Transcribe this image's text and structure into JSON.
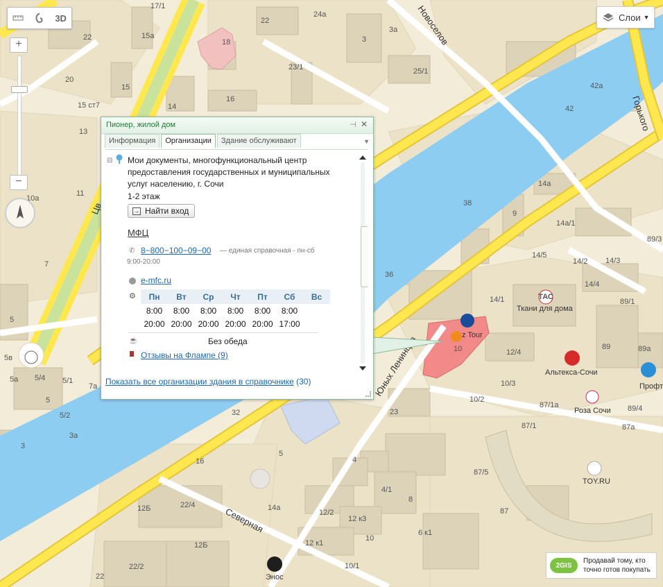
{
  "toolbar": {
    "ruler_icon": "ruler-icon",
    "lasso_icon": "lasso-icon",
    "mode_3d": "3D"
  },
  "zoom": {
    "plus": "+",
    "minus": "−"
  },
  "layers": {
    "label": "Слои"
  },
  "map": {
    "streets": [
      "Новоселов",
      "Горького",
      "Юных Ленинцев",
      "Северная",
      "Цв"
    ],
    "buildings": [
      "17/1",
      "24а",
      "22",
      "15а",
      "3а",
      "18",
      "22",
      "3",
      "20",
      "23/1",
      "25/1",
      "42а",
      "15 ст7",
      "15",
      "16",
      "14",
      "42",
      "13",
      "38",
      "9",
      "14а",
      "14а/1",
      "11",
      "10а",
      "7",
      "36",
      "14/5",
      "14/2",
      "14/3",
      "89/3",
      "14/4",
      "89/1",
      "14/1",
      "89",
      "89а",
      "12/4",
      "10",
      "5",
      "5в",
      "5а",
      "5/4",
      "5/1",
      "7а",
      "5",
      "5/2",
      "3а",
      "3",
      "32",
      "23",
      "10/3",
      "10/2",
      "87/1а",
      "89/4",
      "87а",
      "87/1",
      "87/5",
      "87",
      "12Б",
      "22/4",
      "16",
      "4",
      "5",
      "14а",
      "4/1",
      "8",
      "12/2",
      "12 к3",
      "6 к1",
      "12 к1",
      "10",
      "12Б",
      "22/2",
      "10/1",
      "22"
    ],
    "pois": {
      "tas": "Ткани для дома",
      "alteksa": "Альтекса-Сочи",
      "roza": "Роза Сочи",
      "toy": "TOY.RU",
      "profteks": "Профтекс",
      "enos": "Энос",
      "eztour": "z Tour"
    },
    "tas_logo": "ТАС"
  },
  "card": {
    "title": "Пионер, жилой дом",
    "tabs": [
      "Информация",
      "Организации",
      "Здание обслуживают"
    ],
    "active_tab": 1,
    "org": {
      "name": "Мои документы, многофункциональный центр предоставления государственных и муниципальных услуг населению, г. Сочи",
      "floor": "1-2 этаж",
      "find_entrance": "Найти вход",
      "category": "МФЦ",
      "phone": "8−800−100−09−00",
      "phone_note": "— единая справочная - пн-сб",
      "phone_hours": "9:00-20:00",
      "website": "e-mfc.ru",
      "hours": {
        "days": [
          "Пн",
          "Вт",
          "Ср",
          "Чт",
          "Пт",
          "Сб",
          "Вс"
        ],
        "open": [
          "8:00",
          "8:00",
          "8:00",
          "8:00",
          "8:00",
          "8:00",
          ""
        ],
        "close": [
          "20:00",
          "20:00",
          "20:00",
          "20:00",
          "20:00",
          "17:00",
          ""
        ]
      },
      "lunch": "Без обеда",
      "reviews": "Отзывы на Флампе (9)"
    },
    "show_all": {
      "text": "Показать все организации здания в справочнике",
      "count": "(30)"
    }
  },
  "ad": {
    "logo": "2GIS",
    "line1": "Продавай тому, кто",
    "line2": "точно готов покупать"
  },
  "colors": {
    "land": "#f2ecd9",
    "block": "#ebe2c7",
    "building": "#ddd3b9",
    "road": "#ffe84f",
    "road_edge": "#e3c53c",
    "water": "#8ecdf2",
    "park": "#c9e39d",
    "highlight": "#f28a8a",
    "accent": "#237a3a",
    "link": "#1a67b5"
  }
}
